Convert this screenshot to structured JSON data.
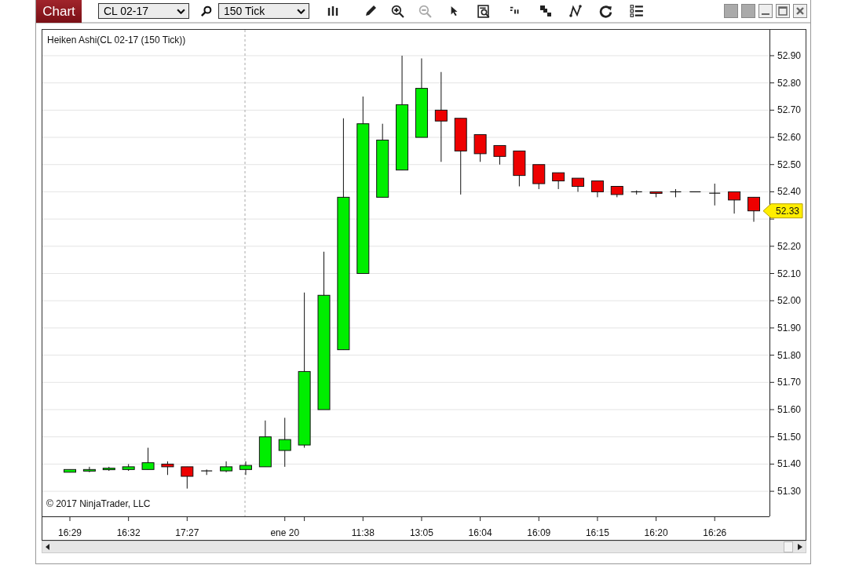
{
  "toolbar": {
    "chart_button": "Chart",
    "instrument": "CL 02-17",
    "interval": "150 Tick"
  },
  "chart": {
    "title": "Heiken Ashi(CL 02-17 (150 Tick))",
    "copyright": "© 2017 NinjaTrader, LLC",
    "price_marker": "52.33",
    "chart_data": {
      "type": "candlestick",
      "categories": [
        "16:29",
        null,
        null,
        "16:32",
        null,
        null,
        "17:27",
        null,
        null,
        null,
        null,
        "ene 20",
        null,
        null,
        null,
        "11:38",
        null,
        null,
        "13:05",
        null,
        null,
        "16:04",
        null,
        null,
        "16:09",
        null,
        null,
        "16:15",
        null,
        null,
        "16:20",
        null,
        null,
        "16:26",
        null,
        null
      ],
      "ylim": [
        51.208,
        52.995
      ],
      "grid": true,
      "ohlc": [
        [
          51.37,
          51.38,
          51.37,
          51.38
        ],
        [
          51.375,
          51.39,
          51.37,
          51.38
        ],
        [
          51.38,
          51.39,
          51.375,
          51.385
        ],
        [
          51.38,
          51.4,
          51.375,
          51.39
        ],
        [
          51.38,
          51.46,
          51.38,
          51.405
        ],
        [
          51.4,
          51.41,
          51.36,
          51.39
        ],
        [
          51.39,
          51.39,
          51.31,
          51.355
        ],
        [
          51.375,
          51.38,
          51.36,
          51.375
        ],
        [
          51.375,
          51.41,
          51.37,
          51.39
        ],
        [
          51.38,
          51.41,
          51.36,
          51.395
        ],
        [
          51.39,
          51.56,
          51.39,
          51.5
        ],
        [
          51.45,
          51.57,
          51.39,
          51.49
        ],
        [
          51.47,
          52.03,
          51.46,
          51.74
        ],
        [
          51.6,
          52.18,
          51.6,
          52.02
        ],
        [
          51.82,
          52.67,
          51.82,
          52.38
        ],
        [
          52.1,
          52.75,
          52.1,
          52.65
        ],
        [
          52.38,
          52.65,
          52.38,
          52.59
        ],
        [
          52.48,
          52.9,
          52.48,
          52.72
        ],
        [
          52.6,
          52.89,
          52.6,
          52.78
        ],
        [
          52.7,
          52.84,
          52.51,
          52.66
        ],
        [
          52.67,
          52.67,
          52.39,
          52.55
        ],
        [
          52.61,
          52.61,
          52.51,
          52.54
        ],
        [
          52.57,
          52.57,
          52.5,
          52.53
        ],
        [
          52.55,
          52.55,
          52.42,
          52.46
        ],
        [
          52.5,
          52.5,
          52.41,
          52.43
        ],
        [
          52.47,
          52.47,
          52.41,
          52.44
        ],
        [
          52.45,
          52.45,
          52.4,
          52.42
        ],
        [
          52.44,
          52.44,
          52.38,
          52.4
        ],
        [
          52.42,
          52.42,
          52.38,
          52.39
        ],
        [
          52.4,
          52.405,
          52.39,
          52.4
        ],
        [
          52.4,
          52.4,
          52.38,
          52.395
        ],
        [
          52.4,
          52.41,
          52.38,
          52.4
        ],
        [
          52.4,
          52.4,
          52.4,
          52.4
        ],
        [
          52.395,
          52.43,
          52.35,
          52.395
        ],
        [
          52.4,
          52.4,
          52.32,
          52.37
        ],
        [
          52.38,
          52.38,
          52.29,
          52.33
        ]
      ],
      "yticks": [
        {
          "value": 52.9,
          "label": "52.90"
        },
        {
          "value": 52.8,
          "label": "52.80"
        },
        {
          "value": 52.7,
          "label": "52.70"
        },
        {
          "value": 52.6,
          "label": "52.60"
        },
        {
          "value": 52.5,
          "label": "52.50"
        },
        {
          "value": 52.4,
          "label": "52.40"
        },
        {
          "value": 52.2,
          "label": "52.20"
        },
        {
          "value": 52.1,
          "label": "52.10"
        },
        {
          "value": 52.0,
          "label": "52.00"
        },
        {
          "value": 51.9,
          "label": "51.90"
        },
        {
          "value": 51.8,
          "label": "51.80"
        },
        {
          "value": 51.7,
          "label": "51.70"
        },
        {
          "value": 51.6,
          "label": "51.60"
        },
        {
          "value": 51.5,
          "label": "51.50"
        },
        {
          "value": 51.4,
          "label": "51.40"
        },
        {
          "value": 51.3,
          "label": "51.30"
        }
      ]
    }
  }
}
